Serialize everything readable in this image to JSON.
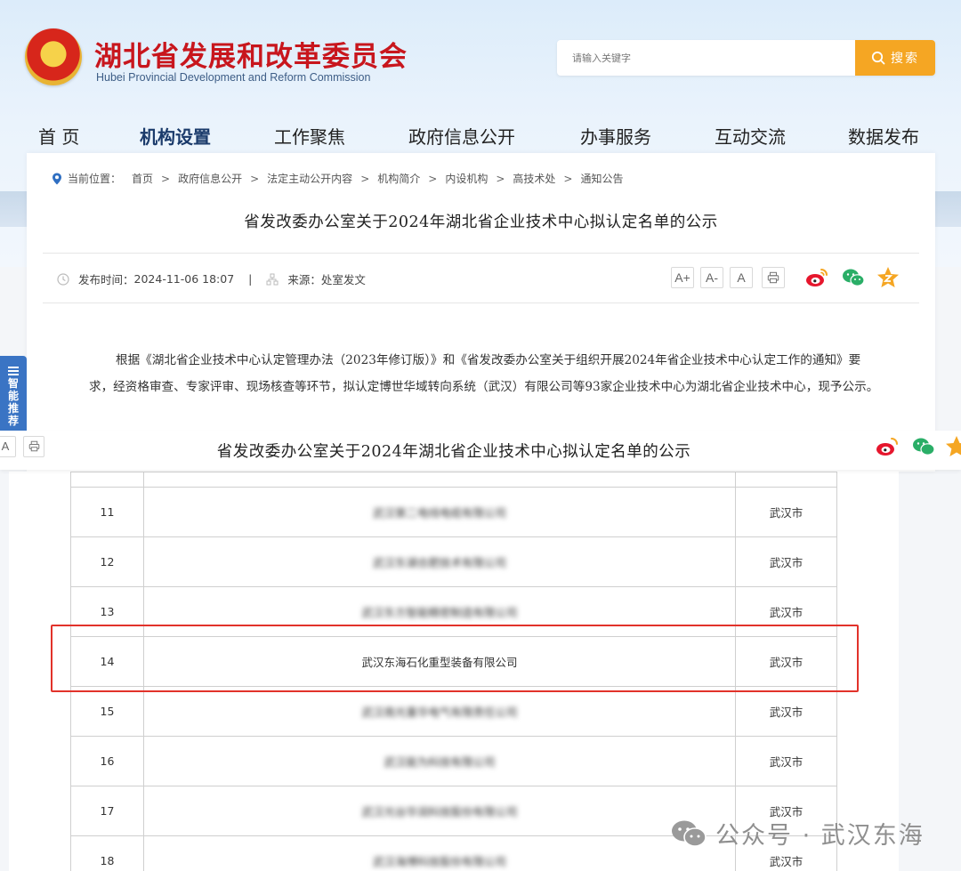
{
  "header": {
    "site_title": "湖北省发展和改革委员会",
    "site_subtitle": "Hubei Provincial Development and Reform Commission",
    "search_placeholder": "请输入关键字",
    "search_button": "搜索"
  },
  "nav": {
    "items": [
      "首 页",
      "机构设置",
      "工作聚焦",
      "政府信息公开",
      "办事服务",
      "互动交流",
      "数据发布"
    ],
    "active": "机构设置"
  },
  "breadcrumb": {
    "label": "当前位置：",
    "items": [
      "首页",
      "政府信息公开",
      "法定主动公开内容",
      "机构简介",
      "内设机构",
      "高技术处",
      "通知公告"
    ]
  },
  "article": {
    "title": "省发改委办公室关于2024年湖北省企业技术中心拟认定名单的公示",
    "publish_label": "发布时间：",
    "publish_time": "2024-11-06 18:07",
    "divider": "|",
    "source_label": "来源：",
    "source": "处室发文",
    "font_buttons": [
      "A+",
      "A-",
      "A"
    ],
    "body": "根据《湖北省企业技术中心认定管理办法（2023年修订版）》和《省发改委办公室关于组织开展2024年省企业技术中心认定工作的通知》要求，经资格审查、专家评审、现场核查等环节，拟认定博世华域转向系统（武汉）有限公司等93家企业技术中心为湖北省企业技术中心，现予公示。"
  },
  "sticky": {
    "title": "省发改委办公室关于2024年湖北省企业技术中心拟认定名单的公示",
    "font_button": "A"
  },
  "side_tab": {
    "label": "智能推荐"
  },
  "table": {
    "rows": [
      {
        "no": "11",
        "company": "武汉第二电线电缆有限公司",
        "city": "武汉市",
        "blurred": true
      },
      {
        "no": "12",
        "company": "武汉东湖合肥技术有限公司",
        "city": "武汉市",
        "blurred": true
      },
      {
        "no": "13",
        "company": "武汉东方智能精密制造有限公司",
        "city": "武汉市",
        "blurred": true
      },
      {
        "no": "14",
        "company": "武汉东海石化重型装备有限公司",
        "city": "武汉市",
        "blurred": false
      },
      {
        "no": "15",
        "company": "武汉南光重华电气有限责任公司",
        "city": "武汉市",
        "blurred": true
      },
      {
        "no": "16",
        "company": "武汉能为科技有限公司",
        "city": "武汉市",
        "blurred": true
      },
      {
        "no": "17",
        "company": "武汉光谷华润科技股份有限公司",
        "city": "武汉市",
        "blurred": true
      },
      {
        "no": "18",
        "company": "武汉海博科技股份有限公司",
        "city": "武汉市",
        "blurred": true
      }
    ]
  },
  "watermark": {
    "text": "公众号 · 武汉东海"
  },
  "colors": {
    "title_red": "#c8161d",
    "search_orange": "#f5a623",
    "highlight_red": "#e2322a",
    "side_tab_blue": "#3a74c4"
  }
}
